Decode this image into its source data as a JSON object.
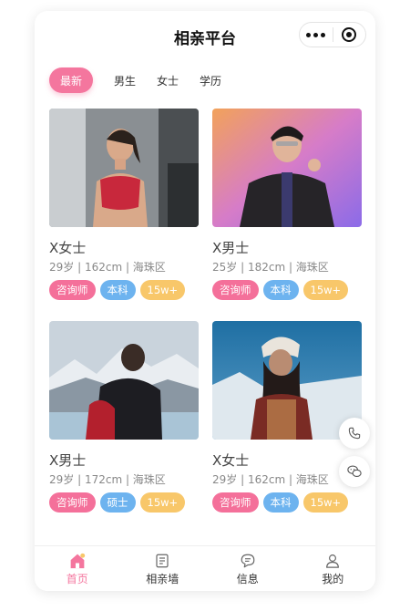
{
  "header": {
    "title": "相亲平台"
  },
  "tabs": [
    {
      "label": "最新",
      "active": true
    },
    {
      "label": "男生"
    },
    {
      "label": "女士"
    },
    {
      "label": "学历"
    }
  ],
  "profiles": [
    {
      "name": "X女士",
      "info": "29岁 | 162cm | 海珠区",
      "tags": [
        "咨询师",
        "本科",
        "15w+"
      ]
    },
    {
      "name": "X男士",
      "info": "25岁 | 182cm | 海珠区",
      "tags": [
        "咨询师",
        "本科",
        "15w+"
      ]
    },
    {
      "name": "X男士",
      "info": "29岁 | 172cm | 海珠区",
      "tags": [
        "咨询师",
        "硕士",
        "15w+"
      ]
    },
    {
      "name": "X女士",
      "info": "29岁 | 162cm | 海珠区",
      "tags": [
        "咨询师",
        "本科",
        "15w+"
      ]
    }
  ],
  "tabbar": [
    {
      "label": "首页",
      "icon": "home-icon",
      "active": true
    },
    {
      "label": "相亲墙",
      "icon": "notes-icon"
    },
    {
      "label": "信息",
      "icon": "chat-bubble-icon"
    },
    {
      "label": "我的",
      "icon": "person-icon"
    }
  ],
  "floating": [
    {
      "icon": "phone-icon"
    },
    {
      "icon": "wechat-icon"
    }
  ],
  "colors": {
    "accent": "#f4769e",
    "job_tag": "#f4709a",
    "edu_tag": "#6db3ef",
    "income_tag": "#f8c76a"
  }
}
